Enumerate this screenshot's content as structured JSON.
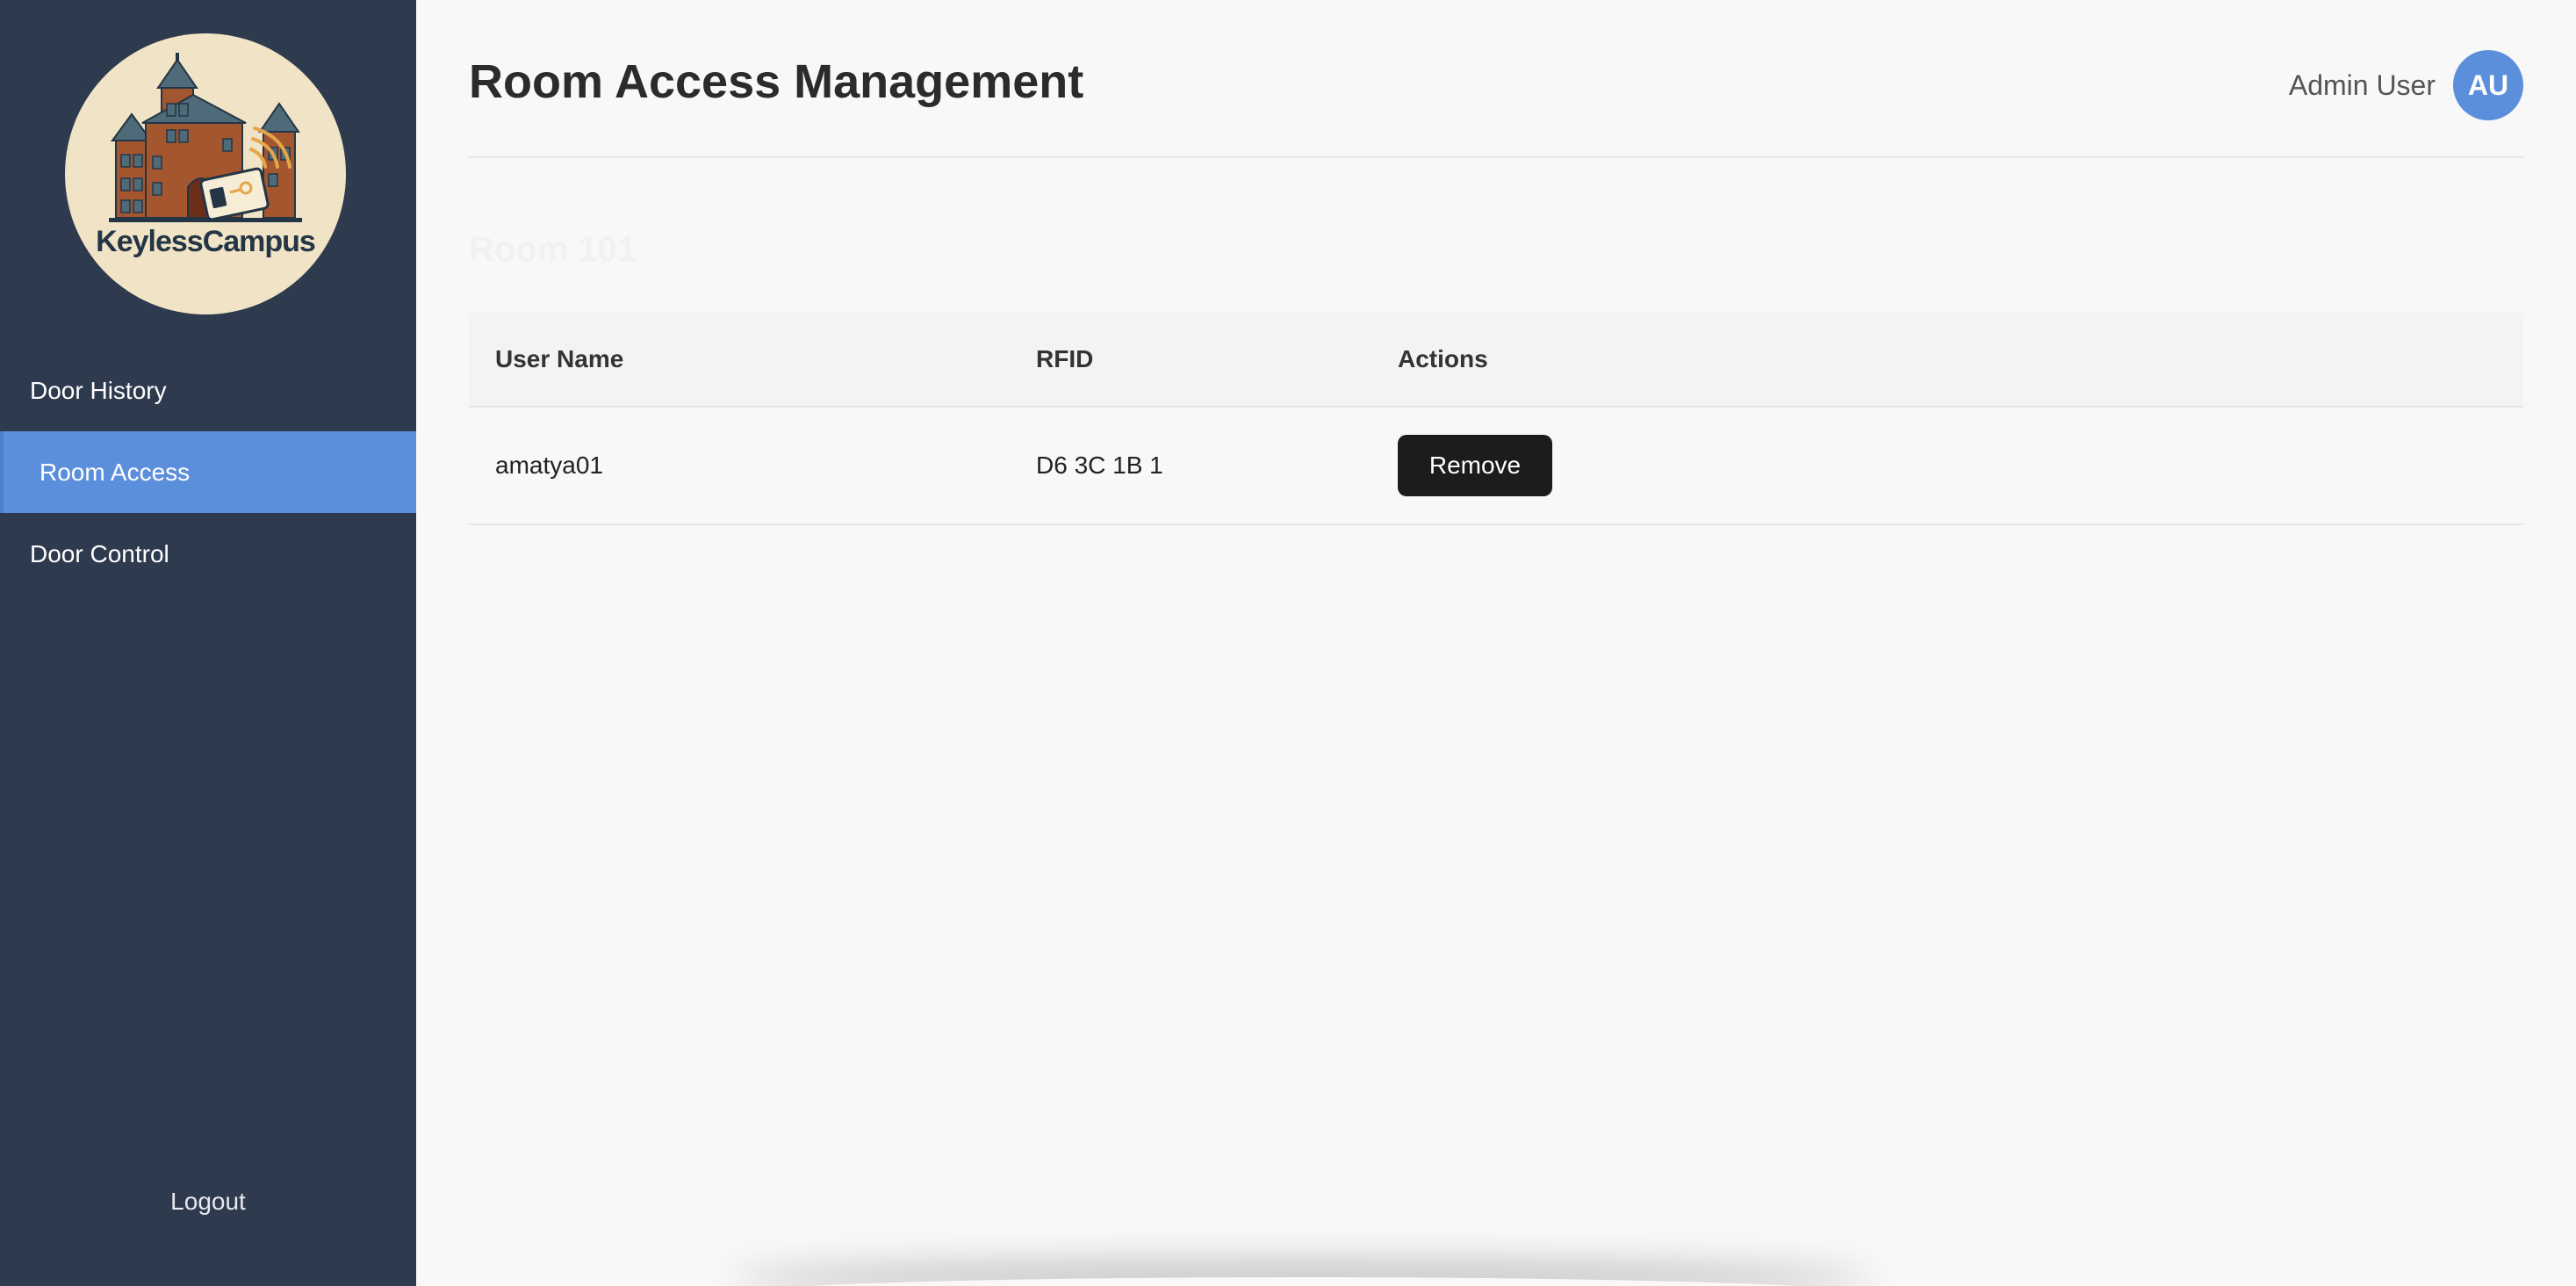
{
  "brand": {
    "name": "KeylessCampus",
    "logo_colors": {
      "circle": "#f1e4c6",
      "brick": "#a4562f",
      "roof": "#4f6a78",
      "dark": "#243646",
      "accent": "#e3a64a"
    }
  },
  "sidebar": {
    "items": [
      {
        "label": "Door History",
        "active": false
      },
      {
        "label": "Room Access",
        "active": true
      },
      {
        "label": "Door Control",
        "active": false
      }
    ],
    "logout_label": "Logout",
    "background": "#2e3a4d",
    "active_color": "#5b8fdc"
  },
  "header": {
    "title": "Room Access Management",
    "user_name": "Admin User",
    "avatar_initials": "AU"
  },
  "room": {
    "title": "Room 101"
  },
  "table": {
    "headers": [
      "User Name",
      "RFID",
      "Actions"
    ],
    "rows": [
      {
        "user_name": "amatya01",
        "rfid": "D6 3C 1B 1",
        "action_label": "Remove"
      }
    ]
  }
}
